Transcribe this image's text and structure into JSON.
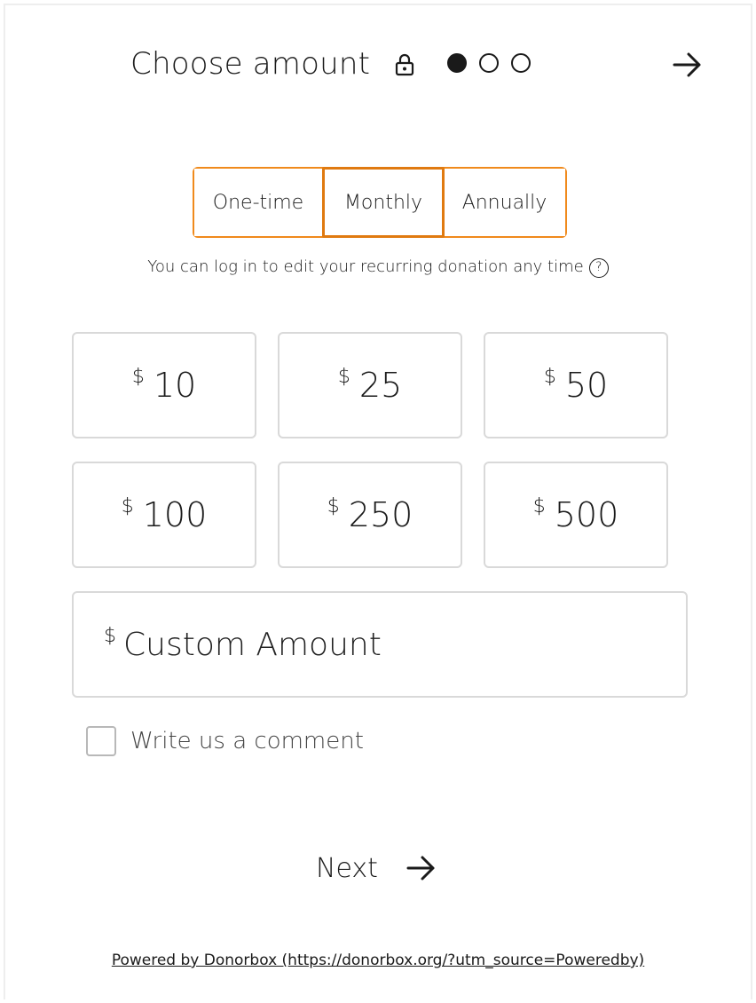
{
  "header": {
    "title": "Choose amount",
    "lock_icon": "lock-icon",
    "steps": [
      {
        "state": "active"
      },
      {
        "state": "inactive"
      },
      {
        "state": "inactive"
      }
    ],
    "next_icon": "arrow-right-icon"
  },
  "frequency": {
    "options": [
      {
        "label": "One-time"
      },
      {
        "label": "Monthly"
      },
      {
        "label": "Annually"
      }
    ],
    "selected": "Monthly",
    "accent_color": "#f08a1c"
  },
  "info": {
    "text": "You can log in to edit your recurring donation any time",
    "help_icon_glyph": "?"
  },
  "amounts": {
    "currency": "$",
    "values": [
      "10",
      "25",
      "50",
      "100",
      "250",
      "500"
    ]
  },
  "custom": {
    "currency": "$",
    "placeholder": "Custom Amount"
  },
  "comment": {
    "label": "Write us a comment",
    "checked": false
  },
  "next": {
    "label": "Next"
  },
  "footer": {
    "powered_by": "Powered by Donorbox (https://donorbox.org/?utm_source=Poweredby)"
  }
}
